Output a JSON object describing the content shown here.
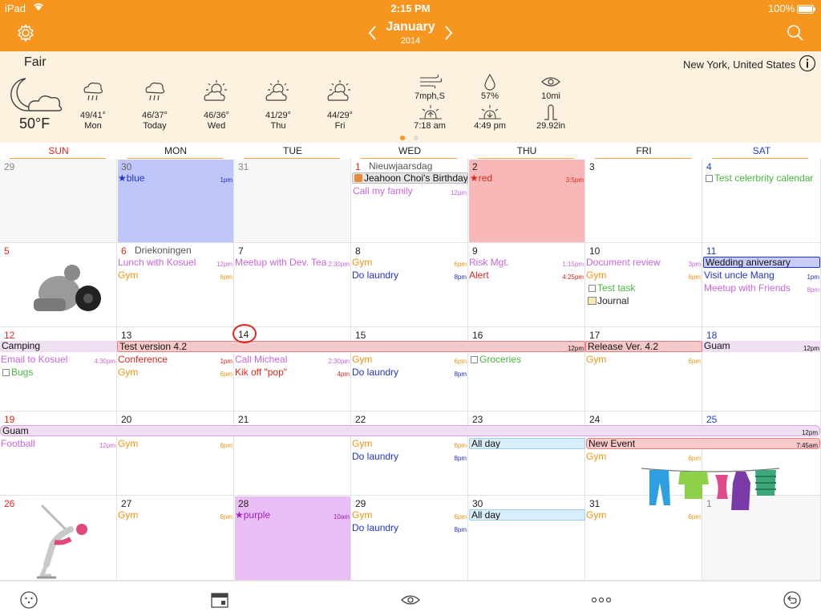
{
  "status_bar": {
    "device": "iPad",
    "time": "2:15 PM",
    "battery": "100%"
  },
  "header": {
    "month": "January",
    "year": "2014",
    "settings_icon": "gear-icon",
    "search_icon": "search-icon"
  },
  "weather": {
    "condition": "Fair",
    "location": "New York, United States",
    "current_temp": "50°F",
    "forecast": [
      {
        "temps": "49/41°",
        "day": "Mon",
        "icon": "rain-cloud-icon"
      },
      {
        "temps": "46/37°",
        "day": "Today",
        "icon": "rain-cloud-icon"
      },
      {
        "temps": "46/36°",
        "day": "Wed",
        "icon": "partly-cloudy-icon"
      },
      {
        "temps": "41/29°",
        "day": "Thu",
        "icon": "partly-cloudy-icon"
      },
      {
        "temps": "44/29°",
        "day": "Fri",
        "icon": "partly-cloudy-icon"
      }
    ],
    "details": {
      "wind": "7mph,S",
      "humidity": "57%",
      "visibility": "10mi",
      "sunrise": "7:18 am",
      "sunset": "4:49 pm",
      "pressure": "29.92in"
    }
  },
  "day_headers": [
    "SUN",
    "MON",
    "TUE",
    "WED",
    "THU",
    "FRI",
    "SAT"
  ],
  "colors": {
    "accent": "#f7961f",
    "sunday": "#e0271e",
    "saturday": "#1f3fd0"
  },
  "weeks": [
    {
      "days": [
        {
          "num": "29",
          "events": []
        },
        {
          "num": "30",
          "events": [
            {
              "text": "★blue",
              "time": "1pm"
            }
          ]
        },
        {
          "num": "31",
          "events": []
        },
        {
          "num": "1",
          "label": "Nieuwjaarsdag",
          "events": [
            {
              "text": "Jeahoon Choi's Birthday"
            },
            {
              "text": "Call my family",
              "time": "12pm"
            }
          ]
        },
        {
          "num": "2",
          "events": [
            {
              "text": "★red",
              "time": "3:5pm"
            }
          ]
        },
        {
          "num": "3",
          "events": []
        },
        {
          "num": "4",
          "events": [
            {
              "text": "Test celerbrity calendar"
            }
          ]
        }
      ]
    },
    {
      "days": [
        {
          "num": "5",
          "events": []
        },
        {
          "num": "6",
          "label": "Driekoningen",
          "events": [
            {
              "text": "Lunch with Kosuel",
              "time": "12pm"
            },
            {
              "text": "Gym",
              "time": "6pm"
            }
          ]
        },
        {
          "num": "7",
          "events": [
            {
              "text": "Meetup with Dev. Team",
              "time": "2:30pm"
            }
          ]
        },
        {
          "num": "8",
          "events": [
            {
              "text": "Gym",
              "time": "6pm"
            },
            {
              "text": "Do laundry",
              "time": "8pm"
            }
          ]
        },
        {
          "num": "9",
          "events": [
            {
              "text": "Risk Mgt.",
              "time": "1:15pm"
            },
            {
              "text": "Alert",
              "time": "4:25pm"
            }
          ]
        },
        {
          "num": "10",
          "events": [
            {
              "text": "Document review",
              "time": "3pm"
            },
            {
              "text": "Gym",
              "time": "6pm"
            },
            {
              "text": "Test task"
            },
            {
              "text": "Journal"
            }
          ]
        },
        {
          "num": "11",
          "events": [
            {
              "text": "Wedding aniversary"
            },
            {
              "text": "Visit uncle Mang",
              "time": "1pm"
            },
            {
              "text": "Meetup with Friends",
              "time": "8pm"
            }
          ]
        }
      ]
    },
    {
      "days": [
        {
          "num": "12",
          "events": [
            {
              "text": "Camping"
            },
            {
              "text": "Email to Kosuel",
              "time": "4:30pm"
            },
            {
              "text": "Bugs"
            }
          ]
        },
        {
          "num": "13",
          "events": [
            {
              "text": "Test version 4.2",
              "time": "12pm"
            },
            {
              "text": "Conference",
              "time": "1pm"
            },
            {
              "text": "Gym",
              "time": "6pm"
            }
          ]
        },
        {
          "num": "14",
          "events": [
            {
              "text": "Call Micheal",
              "time": "2:30pm"
            },
            {
              "text": "Kik off \"pop\"",
              "time": "4pm"
            }
          ]
        },
        {
          "num": "15",
          "events": [
            {
              "text": "Gym",
              "time": "6pm"
            },
            {
              "text": "Do laundry",
              "time": "8pm"
            }
          ]
        },
        {
          "num": "16",
          "events": [
            {
              "text": "Groceries"
            }
          ]
        },
        {
          "num": "17",
          "events": [
            {
              "text": "Release Ver. 4.2"
            },
            {
              "text": "Gym",
              "time": "6pm"
            }
          ]
        },
        {
          "num": "18",
          "events": [
            {
              "text": "Guam",
              "time": "12pm"
            }
          ]
        }
      ]
    },
    {
      "days": [
        {
          "num": "19",
          "events": [
            {
              "text": "Guam",
              "time": "12pm"
            },
            {
              "text": "Football",
              "time": "12pm"
            }
          ]
        },
        {
          "num": "20",
          "events": [
            {
              "text": "Gym",
              "time": "6pm"
            }
          ]
        },
        {
          "num": "21",
          "events": []
        },
        {
          "num": "22",
          "events": [
            {
              "text": "Gym",
              "time": "6pm"
            },
            {
              "text": "Do laundry",
              "time": "8pm"
            }
          ]
        },
        {
          "num": "23",
          "events": [
            {
              "text": "All day"
            }
          ]
        },
        {
          "num": "24",
          "events": [
            {
              "text": "New Event",
              "time": "7:45am"
            },
            {
              "text": "Gym",
              "time": "6pm"
            }
          ]
        },
        {
          "num": "25",
          "events": []
        }
      ]
    },
    {
      "days": [
        {
          "num": "26",
          "events": []
        },
        {
          "num": "27",
          "events": [
            {
              "text": "Gym",
              "time": "6pm"
            }
          ]
        },
        {
          "num": "28",
          "events": [
            {
              "text": "★purple",
              "time": "10am"
            }
          ]
        },
        {
          "num": "29",
          "events": [
            {
              "text": "Gym",
              "time": "6pm"
            },
            {
              "text": "Do laundry",
              "time": "8pm"
            }
          ]
        },
        {
          "num": "30",
          "events": [
            {
              "text": "All day"
            }
          ]
        },
        {
          "num": "31",
          "events": [
            {
              "text": "Gym",
              "time": "6pm"
            }
          ]
        },
        {
          "num": "1",
          "events": []
        }
      ]
    }
  ],
  "bottom_bar": [
    {
      "icon": "face-icon"
    },
    {
      "icon": "calendar-icon"
    },
    {
      "icon": "eye-icon"
    },
    {
      "icon": "more-icon"
    },
    {
      "icon": "undo-icon"
    }
  ]
}
